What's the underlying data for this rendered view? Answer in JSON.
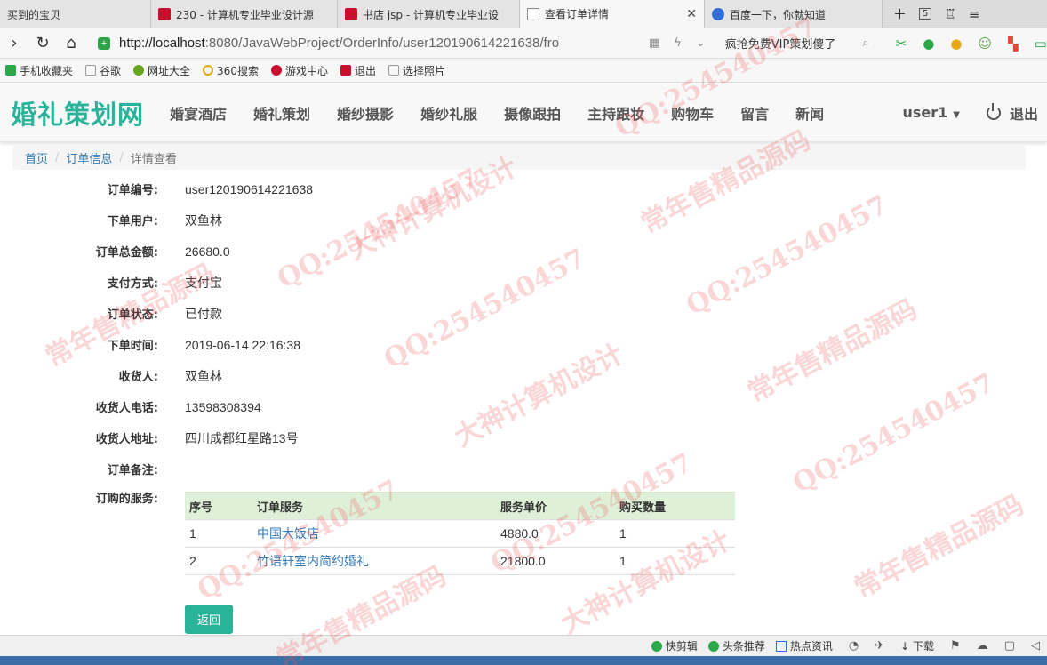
{
  "browser": {
    "tabs": [
      {
        "label": "买到的宝贝",
        "icon": "none",
        "active": false
      },
      {
        "label": "230 - 计算机专业毕业设计源",
        "icon": "red",
        "active": false
      },
      {
        "label": "书店 jsp - 计算机专业毕业设",
        "icon": "red",
        "active": false
      },
      {
        "label": "查看订单详情",
        "icon": "doc",
        "active": true
      },
      {
        "label": "百度一下，你就知道",
        "icon": "paw",
        "active": false
      }
    ],
    "tab_counter": "5",
    "url_host": "http://localhost",
    "url_rest": ":8080/JavaWebProject/OrderInfo/user120190614221638/fro",
    "promo_text": "疯抢免费VIP策划傻了",
    "bookmarks": [
      "手机收藏夹",
      "谷歌",
      "网址大全",
      "360搜索",
      "游戏中心",
      "退出",
      "选择照片"
    ]
  },
  "site": {
    "brand": "婚礼策划网",
    "menu": [
      "婚宴酒店",
      "婚礼策划",
      "婚纱摄影",
      "婚纱礼服",
      "摄像跟拍",
      "主持跟妆",
      "购物车",
      "留言",
      "新闻"
    ],
    "user": "user1",
    "logout": "退出"
  },
  "breadcrumb": {
    "home": "首页",
    "section": "订单信息",
    "current": "详情查看"
  },
  "order": {
    "fields": [
      {
        "label": "订单编号:",
        "value": "user120190614221638"
      },
      {
        "label": "下单用户:",
        "value": "双鱼林"
      },
      {
        "label": "订单总金额:",
        "value": "26680.0"
      },
      {
        "label": "支付方式:",
        "value": "支付宝"
      },
      {
        "label": "订单状态:",
        "value": "已付款"
      },
      {
        "label": "下单时间:",
        "value": "2019-06-14 22:16:38"
      },
      {
        "label": "收货人:",
        "value": "双鱼林"
      },
      {
        "label": "收货人电话:",
        "value": "13598308394"
      },
      {
        "label": "收货人地址:",
        "value": "四川成都红星路13号"
      },
      {
        "label": "订单备注:",
        "value": ""
      }
    ],
    "services_label": "订购的服务:",
    "table": {
      "headers": [
        "序号",
        "订单服务",
        "服务单价",
        "购买数量"
      ],
      "rows": [
        {
          "no": "1",
          "service": "中国大饭店",
          "price": "4880.0",
          "qty": "1"
        },
        {
          "no": "2",
          "service": "竹语轩室内简约婚礼",
          "price": "21800.0",
          "qty": "1"
        }
      ]
    },
    "back_label": "返回"
  },
  "statusbar": {
    "items": [
      "快剪辑",
      "头条推荐",
      "热点资讯",
      "下载"
    ]
  },
  "watermark": {
    "texts": [
      "QQ:254540457",
      "常年售精品源码",
      "大神计算机设计"
    ]
  },
  "colors": {
    "brand": "#2bb39a",
    "link": "#337ab7",
    "table_header": "#dff0d8"
  }
}
